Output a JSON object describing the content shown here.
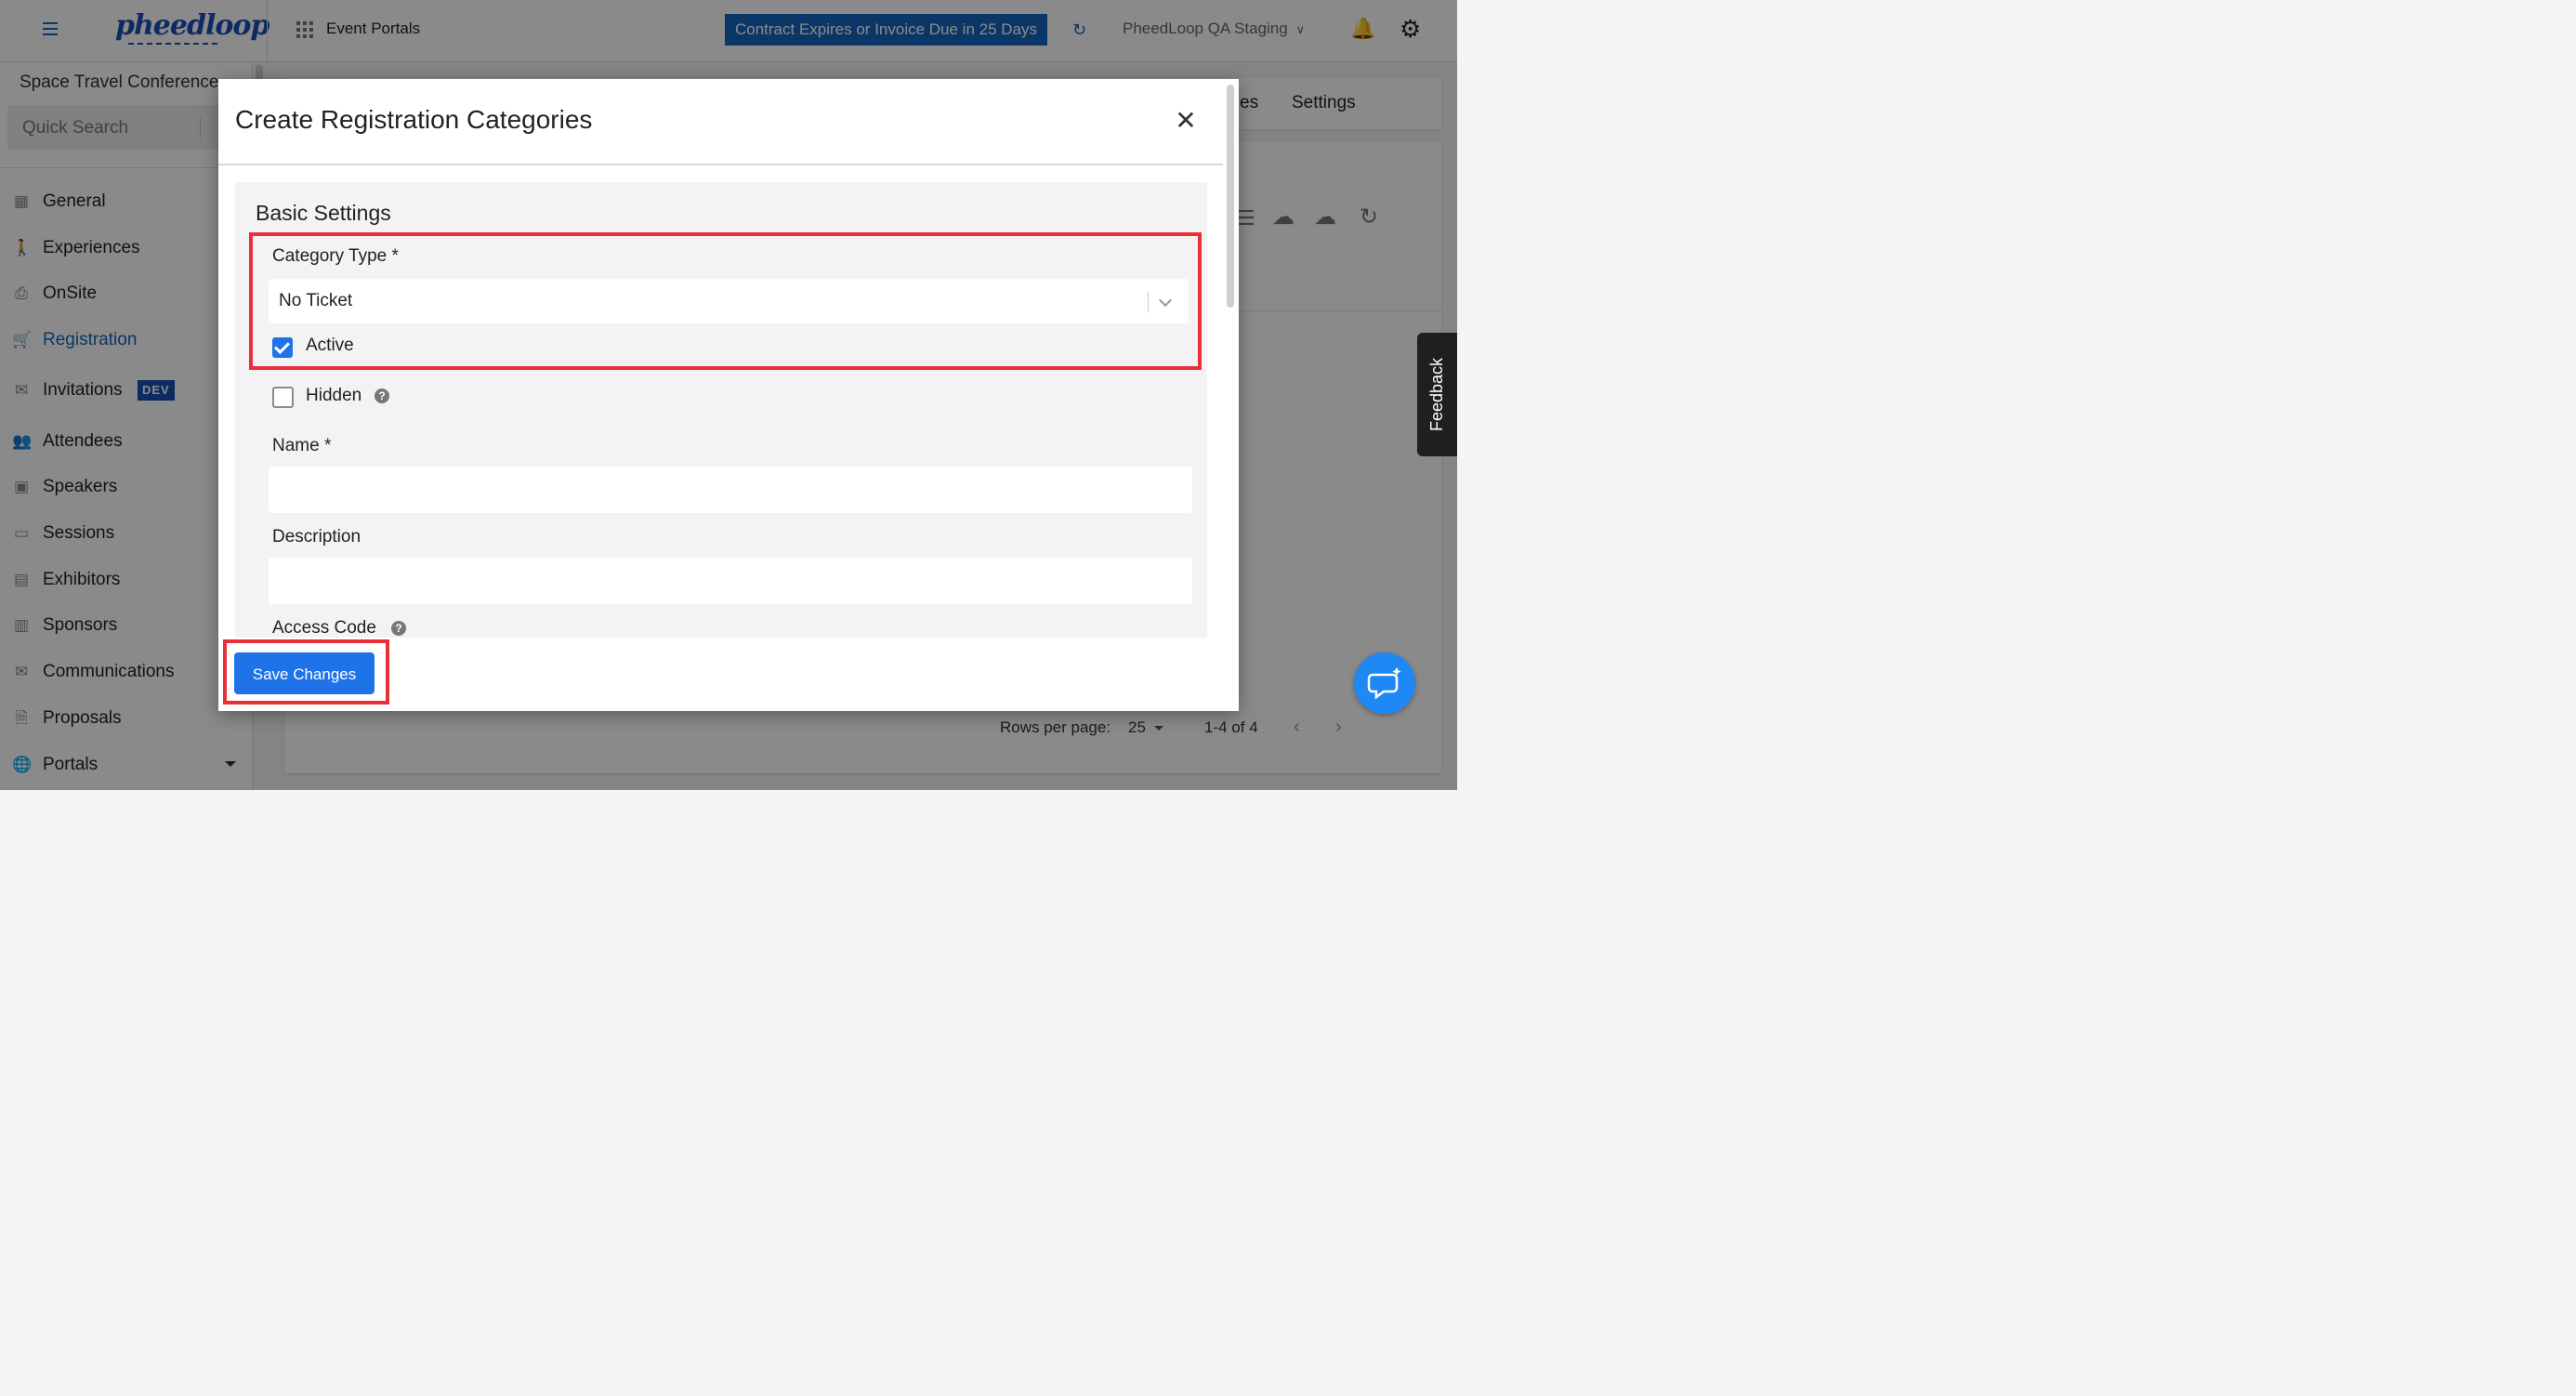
{
  "topbar": {
    "app_name": "pheedloop",
    "portals_label": "Event Portals",
    "contract_banner": "Contract Expires or Invoice Due in 25 Days",
    "organization": "PheedLoop QA Staging",
    "icons": [
      "menu-icon",
      "grid-icon",
      "refresh-icon",
      "chevron-down-icon",
      "bell-icon",
      "gear-icon"
    ]
  },
  "sidebar": {
    "event_name": "Space Travel Conference",
    "search_placeholder": "Quick Search",
    "items": [
      {
        "label": "General",
        "icon": "grid-icon"
      },
      {
        "label": "Experiences",
        "icon": "person-icon"
      },
      {
        "label": "OnSite",
        "icon": "printer-icon"
      },
      {
        "label": "Registration",
        "icon": "cart-icon",
        "active": true
      },
      {
        "label": "Invitations",
        "icon": "mail-icon",
        "badge": "DEV"
      },
      {
        "label": "Attendees",
        "icon": "people-icon"
      },
      {
        "label": "Speakers",
        "icon": "presenter-icon"
      },
      {
        "label": "Sessions",
        "icon": "laptop-icon"
      },
      {
        "label": "Exhibitors",
        "icon": "store-icon"
      },
      {
        "label": "Sponsors",
        "icon": "badge-icon"
      },
      {
        "label": "Communications",
        "icon": "mail-icon"
      },
      {
        "label": "Proposals",
        "icon": "document-icon"
      },
      {
        "label": "Portals",
        "icon": "globe-icon"
      }
    ]
  },
  "background": {
    "tab_partial": "es",
    "tab_settings": "Settings",
    "rows_per_page_label": "Rows per page:",
    "rows_per_page_value": "25",
    "pagination_range": "1-4 of 4"
  },
  "modal": {
    "title": "Create Registration Categories",
    "section_title": "Basic Settings",
    "category_type_label": "Category Type *",
    "category_type_value": "No Ticket",
    "active_label": "Active",
    "active_checked": true,
    "hidden_label": "Hidden",
    "hidden_checked": false,
    "name_label": "Name *",
    "name_value": "",
    "description_label": "Description",
    "description_value": "",
    "access_code_label": "Access Code",
    "save_label": "Save Changes"
  },
  "feedback_label": "Feedback",
  "colors": {
    "brand_blue": "#1565c0",
    "button_blue": "#1e73e8",
    "highlight_red": "#e8303a"
  }
}
